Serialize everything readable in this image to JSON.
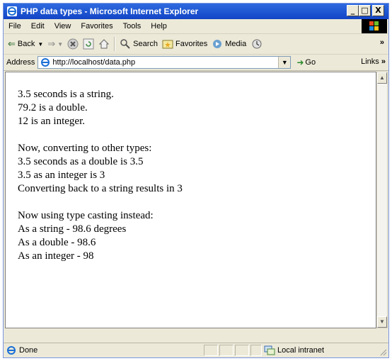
{
  "window": {
    "title": "PHP data types - Microsoft Internet Explorer",
    "buttons": {
      "minimize": "_",
      "maximize": "□",
      "close": "X"
    }
  },
  "menu": [
    "File",
    "Edit",
    "View",
    "Favorites",
    "Tools",
    "Help"
  ],
  "toolbar": {
    "back": "Back",
    "search": "Search",
    "favorites": "Favorites",
    "media": "Media",
    "overflow": "»"
  },
  "address": {
    "label": "Address",
    "url": "http://localhost/data.php",
    "go": "Go",
    "links": "Links",
    "links_chevron": "»"
  },
  "page": {
    "group1": [
      "3.5 seconds is a string.",
      "79.2 is a double.",
      "12 is an integer."
    ],
    "group2": [
      "Now, converting to other types:",
      "3.5 seconds as a double is 3.5",
      "3.5 as an integer is 3",
      "Converting back to a string results in 3"
    ],
    "group3": [
      "Now using type casting instead:",
      "As a string - 98.6 degrees",
      "As a double - 98.6",
      "As an integer - 98"
    ]
  },
  "status": {
    "text": "Done",
    "zone": "Local intranet"
  },
  "icons": {
    "app": "ie-icon",
    "back": "back-arrow-icon",
    "forward": "forward-arrow-icon",
    "stop": "stop-icon",
    "refresh": "refresh-icon",
    "home": "home-icon",
    "search": "search-icon",
    "favorites": "favorites-icon",
    "media": "media-icon",
    "history": "history-icon"
  },
  "colors": {
    "titlebar": "#1f58d6",
    "chrome": "#ece9d8"
  }
}
